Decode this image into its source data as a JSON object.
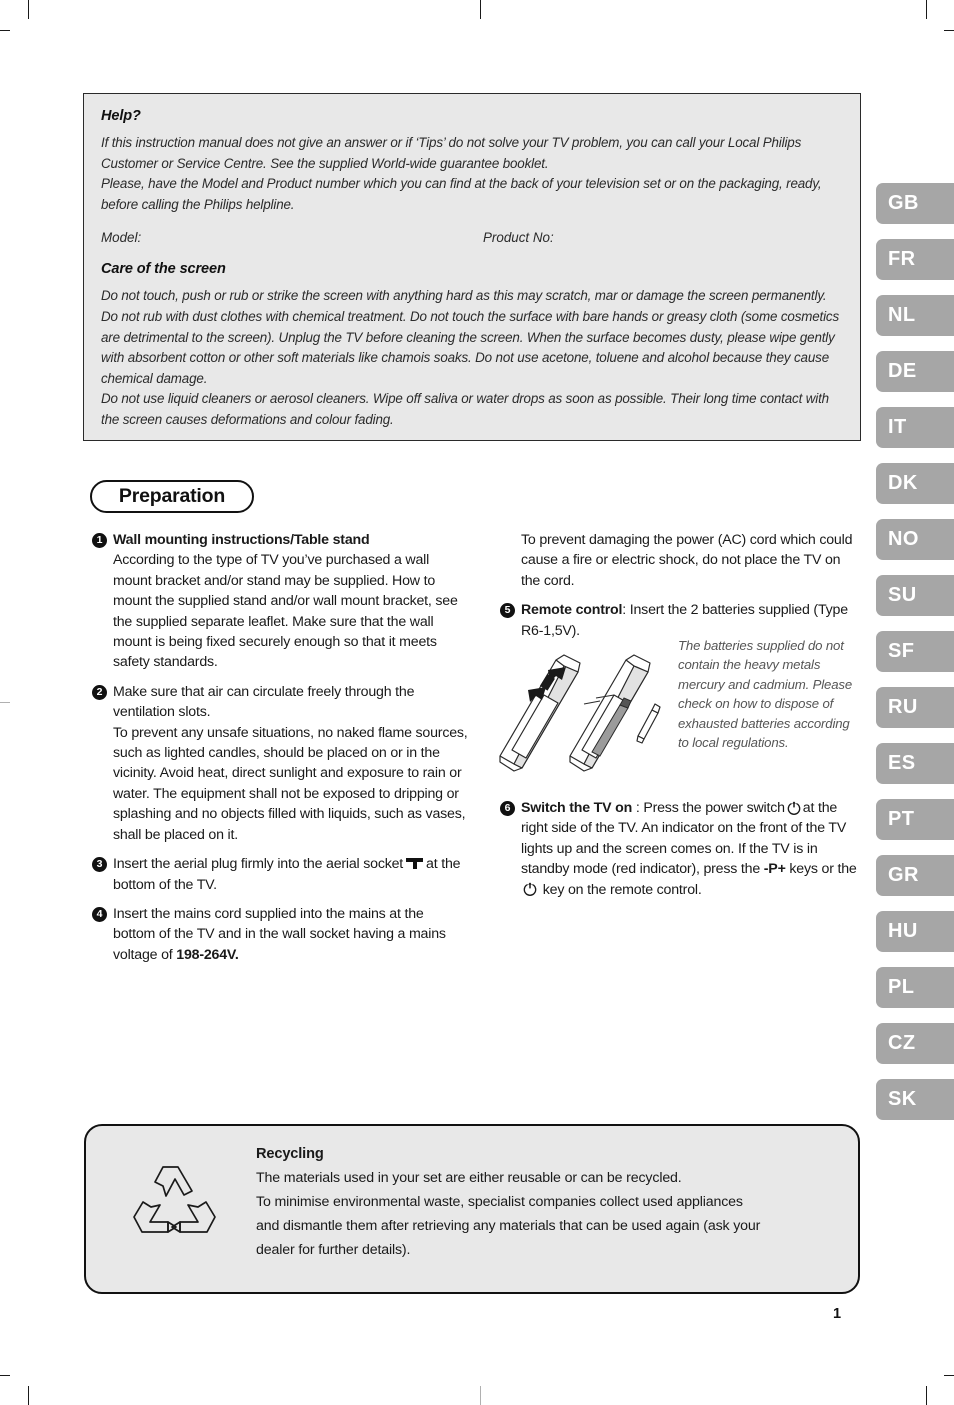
{
  "page": {
    "number": "1"
  },
  "help_box": {
    "heading": "Help?",
    "paragraph1": "If this instruction manual does not give an answer or if ‘Tips’ do not solve your TV problem, you can call your Local Philips Customer or Service Centre. See the supplied World-wide guarantee booklet.",
    "paragraph2": "Please, have the Model and Product number which you can find at the back of your television set or on the packaging, ready, before calling the Philips helpline.",
    "model_label": "Model:",
    "product_label": "Product No:",
    "care_heading": "Care of the screen",
    "care_paragraph1": "Do not touch, push or rub or strike the screen with anything hard as this may scratch, mar or damage the screen permanently. Do not rub with dust clothes with chemical treatment. Do not touch the surface with bare hands or greasy cloth (some cosmetics are detrimental to the screen).  Unplug the TV before cleaning the screen. When the surface becomes dusty, please wipe gently with absorbent cotton or other soft materials like chamois soaks. Do not use acetone, toluene and alcohol because they cause chemical damage.",
    "care_paragraph2": "Do not use liquid cleaners or aerosol cleaners. Wipe off saliva or water drops as soon as possible. Their long time contact with the screen causes deformations and colour fading."
  },
  "section": {
    "title": "Preparation"
  },
  "steps": {
    "step1": {
      "number": "1",
      "title": "Wall mounting instructions/Table stand",
      "text": "According to the type of TV you’ve purchased a wall mount bracket and/or stand may be supplied. How to mount the supplied stand and/or wall mount bracket, see the supplied separate leaflet. Make sure that the wall mount is being fixed securely enough so that it meets safety standards."
    },
    "step2": {
      "number": "2",
      "text1": "Make sure that air can circulate freely through the ventilation slots.",
      "text2": "To prevent any unsafe situations, no naked flame sources, such as lighted candles, should be placed on or in the vicinity. Avoid heat, direct sunlight and exposure to rain or water. The equipment shall not be exposed to dripping or splashing and no objects filled with liquids, such as vases, shall be placed on it."
    },
    "step3": {
      "number": "3",
      "text_before": "Insert the aerial plug firmly into the aerial socket",
      "text_after": "at the bottom of the TV."
    },
    "step4": {
      "number": "4",
      "text": "Insert the mains cord supplied into the mains at the bottom of the TV and in the wall socket having a mains voltage of ",
      "voltage": "198-264V."
    },
    "continuation": "To prevent damaging the power (AC) cord which could cause a fire or electric shock, do not place the TV on the cord.",
    "step5": {
      "number": "5",
      "title": "Remote control",
      "text": ": Insert the 2 batteries supplied (Type R6-1,5V).",
      "note": "The batteries supplied do not contain the heavy metals mercury and cadmium. Please check on how to dispose of exhausted batteries according to local regulations."
    },
    "step6": {
      "number": "6",
      "title": "Switch the TV on",
      "text1": " : Press the power switch",
      "text2": "at the right side of the TV. An indicator on the front of the TV lights up and the screen comes on. If the TV is in standby mode (red indicator), press the ",
      "keys_label": "-P+",
      "text3": " keys or the",
      "text4": "key on the remote control."
    }
  },
  "language_tabs": [
    {
      "code": "GB"
    },
    {
      "code": "FR"
    },
    {
      "code": "NL"
    },
    {
      "code": "DE"
    },
    {
      "code": "IT"
    },
    {
      "code": "DK"
    },
    {
      "code": "NO"
    },
    {
      "code": "SU"
    },
    {
      "code": "SF"
    },
    {
      "code": "RU"
    },
    {
      "code": "ES"
    },
    {
      "code": "PT"
    },
    {
      "code": "GR"
    },
    {
      "code": "HU"
    },
    {
      "code": "PL"
    },
    {
      "code": "CZ"
    },
    {
      "code": "SK"
    }
  ],
  "recycling": {
    "heading": "Recycling",
    "line1": "The materials used in your set are either reusable or can be recycled.",
    "line2": "To minimise environmental waste, specialist companies collect used appliances",
    "line3": "and dismantle them after retrieving any materials that can be used again (ask your",
    "line4": "dealer for further details)."
  },
  "colors": {
    "panel_background": "#e8e8e8",
    "tab_background": "#a6a6a6",
    "tab_text": "#ffffff",
    "text": "#1a1a1a",
    "note_text": "#555555"
  }
}
